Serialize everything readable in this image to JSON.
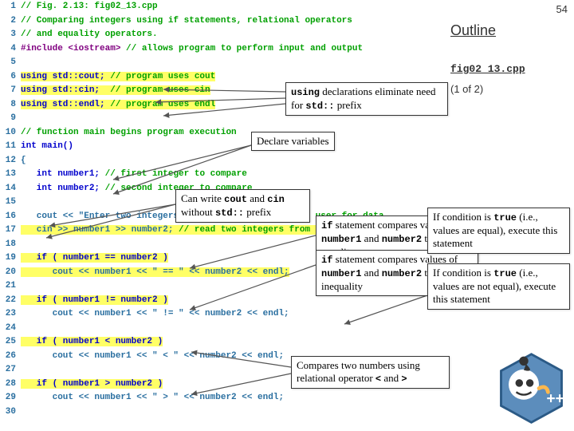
{
  "page_number": "54",
  "outline": "Outline",
  "filename": "fig02_13.cpp",
  "page_of": "(1 of 2)",
  "lines": [
    {
      "n": "1",
      "segs": [
        {
          "t": "// Fig. 2.13: fig02_13.cpp",
          "cls": "comment"
        }
      ]
    },
    {
      "n": "2",
      "segs": [
        {
          "t": "// Comparing integers using if statements, relational operators",
          "cls": "comment"
        }
      ]
    },
    {
      "n": "3",
      "segs": [
        {
          "t": "// and equality operators.",
          "cls": "comment"
        }
      ]
    },
    {
      "n": "4",
      "segs": [
        {
          "t": "#include <iostream>",
          "cls": "preproc"
        },
        {
          "t": " // allows program to perform input and output",
          "cls": "comment"
        }
      ]
    },
    {
      "n": "5",
      "segs": [
        {
          "t": "",
          "cls": ""
        }
      ]
    },
    {
      "n": "6",
      "segs": [
        {
          "t": "using std::cout; ",
          "cls": "keyword hl-yellow"
        },
        {
          "t": "// program uses cout",
          "cls": "comment hl-yellow"
        }
      ]
    },
    {
      "n": "7",
      "segs": [
        {
          "t": "using std::cin;  ",
          "cls": "keyword hl-yellow"
        },
        {
          "t": "// program uses cin",
          "cls": "comment hl-yellow"
        }
      ]
    },
    {
      "n": "8",
      "segs": [
        {
          "t": "using std::endl; ",
          "cls": "keyword hl-yellow"
        },
        {
          "t": "// program uses endl",
          "cls": "comment hl-yellow"
        }
      ]
    },
    {
      "n": "9",
      "segs": [
        {
          "t": "",
          "cls": ""
        }
      ]
    },
    {
      "n": "10",
      "segs": [
        {
          "t": "// function main begins program execution",
          "cls": "comment"
        }
      ]
    },
    {
      "n": "11",
      "segs": [
        {
          "t": "int main()",
          "cls": "keyword"
        }
      ]
    },
    {
      "n": "12",
      "segs": [
        {
          "t": "{",
          "cls": ""
        }
      ]
    },
    {
      "n": "13",
      "segs": [
        {
          "t": "   int number1; ",
          "cls": "keyword"
        },
        {
          "t": "// first integer to compare",
          "cls": "comment"
        }
      ]
    },
    {
      "n": "14",
      "segs": [
        {
          "t": "   int number2; ",
          "cls": "keyword"
        },
        {
          "t": "// second integer to compare",
          "cls": "comment"
        }
      ]
    },
    {
      "n": "15",
      "segs": [
        {
          "t": "",
          "cls": ""
        }
      ]
    },
    {
      "n": "16",
      "segs": [
        {
          "t": "   cout << \"Enter two integers to compare: \"; ",
          "cls": ""
        },
        {
          "t": "// prompt user for data",
          "cls": "comment"
        }
      ]
    },
    {
      "n": "17",
      "segs": [
        {
          "t": "   cin >> number1 >> number2; ",
          "cls": "hl-yellow"
        },
        {
          "t": "// read two integers from user",
          "cls": "comment hl-yellow"
        }
      ]
    },
    {
      "n": "18",
      "segs": [
        {
          "t": "",
          "cls": ""
        }
      ]
    },
    {
      "n": "19",
      "segs": [
        {
          "t": "   if ( number1 == number2 )",
          "cls": "hl-yellow keyword"
        }
      ]
    },
    {
      "n": "20",
      "segs": [
        {
          "t": "      cout << number1 << \" == \" << number2 << endl;",
          "cls": "hl-yellow"
        }
      ]
    },
    {
      "n": "21",
      "segs": [
        {
          "t": "",
          "cls": ""
        }
      ]
    },
    {
      "n": "22",
      "segs": [
        {
          "t": "   if ( number1 != number2 )",
          "cls": "hl-yellow keyword"
        }
      ]
    },
    {
      "n": "23",
      "segs": [
        {
          "t": "      cout << number1 << \" != \" << number2 << endl;",
          "cls": ""
        }
      ]
    },
    {
      "n": "24",
      "segs": [
        {
          "t": "",
          "cls": ""
        }
      ]
    },
    {
      "n": "25",
      "segs": [
        {
          "t": "   if ( number1 < number2 )",
          "cls": "hl-yellow keyword"
        }
      ]
    },
    {
      "n": "26",
      "segs": [
        {
          "t": "      cout << number1 << \" < \" << number2 << endl;",
          "cls": ""
        }
      ]
    },
    {
      "n": "27",
      "segs": [
        {
          "t": "",
          "cls": ""
        }
      ]
    },
    {
      "n": "28",
      "segs": [
        {
          "t": "   if ( number1 > number2 )",
          "cls": "hl-yellow keyword"
        }
      ]
    },
    {
      "n": "29",
      "segs": [
        {
          "t": "      cout << number1 << \" > \" << number2 << endl;",
          "cls": ""
        }
      ]
    },
    {
      "n": "30",
      "segs": [
        {
          "t": "",
          "cls": ""
        }
      ]
    }
  ],
  "ann": {
    "using": {
      "pre": "",
      "b": "using",
      "mid": " declarations eliminate need for ",
      "b2": "std::",
      "post": " prefix"
    },
    "declare": "Declare variables",
    "coutcin": {
      "pre": "Can write ",
      "b": "cout",
      "mid": " and ",
      "b2": "cin",
      "post": " without ",
      "b3": "std::",
      "post2": " prefix"
    },
    "ifeq": {
      "pre": "",
      "b": "if",
      "mid": " statement compares values of ",
      "b2": "number1",
      "mid2": " and ",
      "b3": "number2",
      "post": " to test for equality"
    },
    "ifne": {
      "pre": "",
      "b": "if",
      "mid": " statement compares values of ",
      "b2": "number1",
      "mid2": " and ",
      "b3": "number2",
      "post": " to test for inequality"
    },
    "condtrue_eq": {
      "pre": "If condition is ",
      "b": "true",
      "post": " (i.e., values are equal), execute this statement"
    },
    "condtrue_ne": {
      "pre": "If condition is ",
      "b": "true",
      "post": " (i.e., values are not equal), execute this statement"
    },
    "relop": {
      "pre": "Compares two numbers using relational operator ",
      "b": "<",
      "mid": " and ",
      "b2": ">"
    }
  }
}
